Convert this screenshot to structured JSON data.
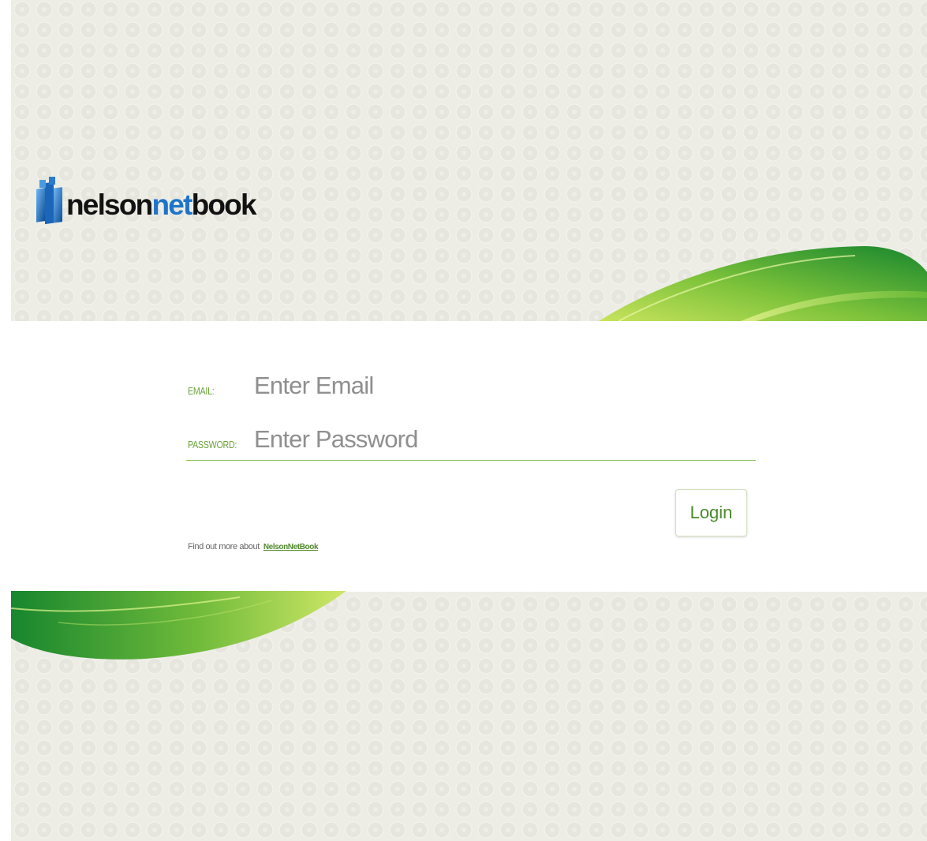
{
  "logo": {
    "part1": "nelson",
    "part2": "net",
    "part3": "book"
  },
  "login": {
    "email_label": "EMAIL:",
    "email_placeholder": "Enter Email",
    "email_value": "",
    "password_label": "PASSWORD:",
    "password_placeholder": "Enter Password",
    "password_value": "",
    "button_label": "Login"
  },
  "footer": {
    "text": "Find out more about",
    "link_text": "NelsonNetBook"
  },
  "colors": {
    "background": "#edede6",
    "accent_green": "#69a33a",
    "swoosh_dark_green": "#1a8a2f",
    "swoosh_light_green": "#9bd03a",
    "logo_blue": "#1d74c9",
    "logo_dark": "#121212"
  },
  "icons": {
    "logo_mark": "nelson-building-logo-icon",
    "background_pattern": "cd-disc-pattern"
  }
}
